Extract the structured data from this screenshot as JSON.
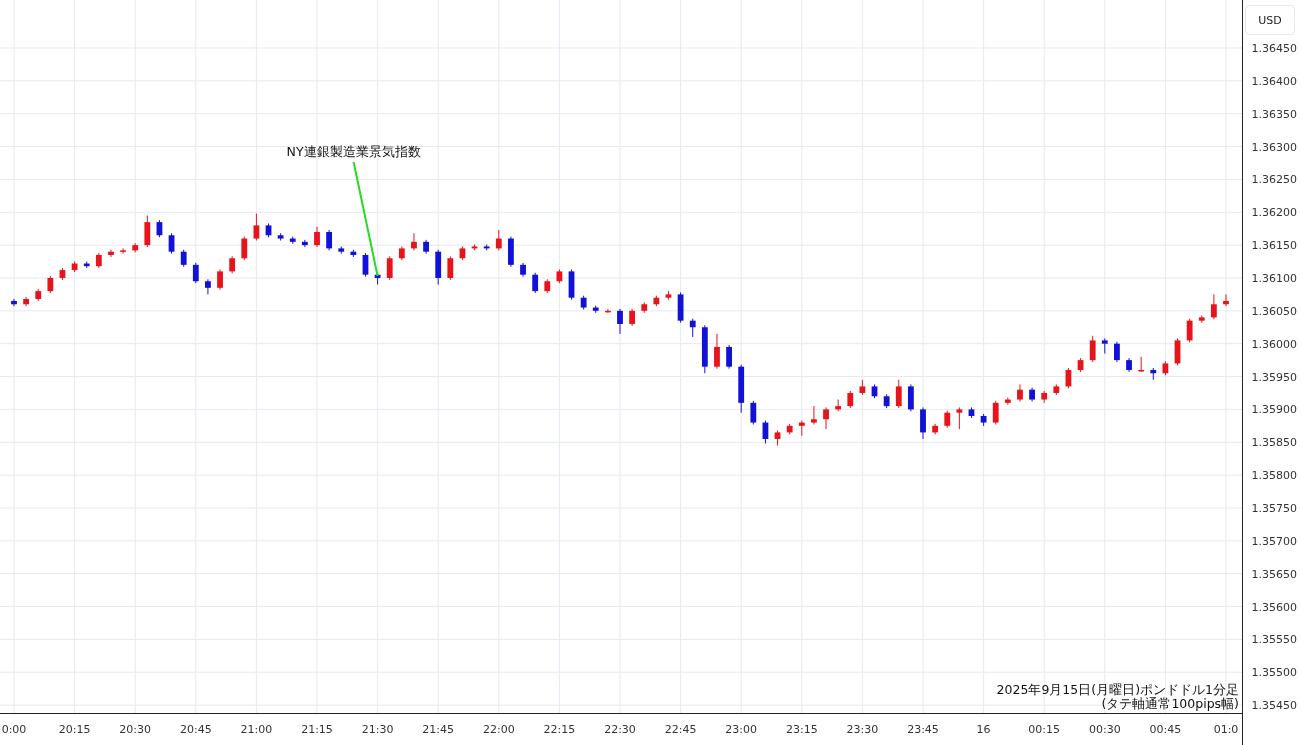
{
  "currency_button": {
    "label": "USD"
  },
  "chart": {
    "chart_data": {
      "type": "candlestick",
      "grid": true,
      "categories": [
        "0:00",
        null,
        null,
        null,
        null,
        "20:15",
        null,
        null,
        null,
        null,
        "20:30",
        null,
        null,
        null,
        null,
        "20:45",
        null,
        null,
        null,
        null,
        "21:00",
        null,
        null,
        null,
        null,
        "21:15",
        null,
        null,
        null,
        null,
        "21:30",
        null,
        null,
        null,
        null,
        "21:45",
        null,
        null,
        null,
        null,
        "22:00",
        null,
        null,
        null,
        null,
        "22:15",
        null,
        null,
        null,
        null,
        "22:30",
        null,
        null,
        null,
        null,
        "22:45",
        null,
        null,
        null,
        null,
        "23:00",
        null,
        null,
        null,
        null,
        "23:15",
        null,
        null,
        null,
        null,
        "23:30",
        null,
        null,
        null,
        null,
        "23:45",
        null,
        null,
        null,
        null,
        "16",
        null,
        null,
        null,
        null,
        "00:15",
        null,
        null,
        null,
        null,
        "00:30",
        null,
        null,
        null,
        null,
        "00:45",
        null,
        null,
        null,
        null,
        "01:0"
      ],
      "ohlc": [
        [
          1.36065,
          1.36068,
          1.36057,
          1.3606
        ],
        [
          1.3606,
          1.36071,
          1.36057,
          1.36068
        ],
        [
          1.36068,
          1.36083,
          1.36065,
          1.3608
        ],
        [
          1.3608,
          1.36103,
          1.36077,
          1.361
        ],
        [
          1.361,
          1.36115,
          1.36097,
          1.36112
        ],
        [
          1.36112,
          1.36125,
          1.36109,
          1.36122
        ],
        [
          1.36122,
          1.36125,
          1.36115,
          1.36118
        ],
        [
          1.36118,
          1.36138,
          1.36115,
          1.36135
        ],
        [
          1.36135,
          1.36143,
          1.36132,
          1.3614
        ],
        [
          1.3614,
          1.36145,
          1.36137,
          1.36142
        ],
        [
          1.36142,
          1.36153,
          1.36139,
          1.3615
        ],
        [
          1.3615,
          1.36195,
          1.36147,
          1.36185
        ],
        [
          1.36185,
          1.36188,
          1.36162,
          1.36165
        ],
        [
          1.36165,
          1.36168,
          1.36137,
          1.3614
        ],
        [
          1.3614,
          1.36143,
          1.36117,
          1.3612
        ],
        [
          1.3612,
          1.36123,
          1.36092,
          1.36095
        ],
        [
          1.36095,
          1.36098,
          1.36075,
          1.36085
        ],
        [
          1.36085,
          1.36113,
          1.36082,
          1.3611
        ],
        [
          1.3611,
          1.36133,
          1.36107,
          1.3613
        ],
        [
          1.3613,
          1.36163,
          1.36127,
          1.3616
        ],
        [
          1.3616,
          1.36198,
          1.36157,
          1.3618
        ],
        [
          1.3618,
          1.36183,
          1.36162,
          1.36165
        ],
        [
          1.36165,
          1.36168,
          1.36157,
          1.3616
        ],
        [
          1.3616,
          1.36163,
          1.36152,
          1.36155
        ],
        [
          1.36155,
          1.36158,
          1.36147,
          1.3615
        ],
        [
          1.3615,
          1.36178,
          1.36147,
          1.3617
        ],
        [
          1.3617,
          1.36173,
          1.36142,
          1.36145
        ],
        [
          1.36145,
          1.36148,
          1.36137,
          1.3614
        ],
        [
          1.3614,
          1.36143,
          1.36132,
          1.36135
        ],
        [
          1.36135,
          1.36138,
          1.36102,
          1.36105
        ],
        [
          1.36105,
          1.36108,
          1.3609,
          1.361
        ],
        [
          1.361,
          1.36133,
          1.36097,
          1.3613
        ],
        [
          1.3613,
          1.36148,
          1.36127,
          1.36145
        ],
        [
          1.36145,
          1.36168,
          1.36142,
          1.36155
        ],
        [
          1.36155,
          1.36158,
          1.36137,
          1.3614
        ],
        [
          1.3614,
          1.36143,
          1.3609,
          1.361
        ],
        [
          1.361,
          1.36133,
          1.36097,
          1.3613
        ],
        [
          1.3613,
          1.36148,
          1.36127,
          1.36145
        ],
        [
          1.36145,
          1.36151,
          1.36142,
          1.36148
        ],
        [
          1.36148,
          1.36151,
          1.36142,
          1.36145
        ],
        [
          1.36145,
          1.36173,
          1.36142,
          1.3616
        ],
        [
          1.3616,
          1.36163,
          1.36117,
          1.3612
        ],
        [
          1.3612,
          1.36123,
          1.36102,
          1.36105
        ],
        [
          1.36105,
          1.36108,
          1.36077,
          1.3608
        ],
        [
          1.3608,
          1.36098,
          1.36077,
          1.36095
        ],
        [
          1.36095,
          1.36113,
          1.36092,
          1.3611
        ],
        [
          1.3611,
          1.36113,
          1.36067,
          1.3607
        ],
        [
          1.3607,
          1.36073,
          1.36052,
          1.36055
        ],
        [
          1.36055,
          1.36058,
          1.36047,
          1.3605
        ],
        [
          1.3605,
          1.36053,
          1.36047,
          1.3605
        ],
        [
          1.3605,
          1.36053,
          1.36015,
          1.3603
        ],
        [
          1.3603,
          1.36053,
          1.36027,
          1.3605
        ],
        [
          1.3605,
          1.36063,
          1.36047,
          1.3606
        ],
        [
          1.3606,
          1.36073,
          1.36057,
          1.3607
        ],
        [
          1.3607,
          1.3608,
          1.36067,
          1.36075
        ],
        [
          1.36075,
          1.36078,
          1.36032,
          1.36035
        ],
        [
          1.36035,
          1.36038,
          1.3601,
          1.36025
        ],
        [
          1.36025,
          1.36028,
          1.35955,
          1.35965
        ],
        [
          1.35965,
          1.36015,
          1.35962,
          1.35995
        ],
        [
          1.35995,
          1.35998,
          1.35962,
          1.35965
        ],
        [
          1.35965,
          1.35968,
          1.35895,
          1.3591
        ],
        [
          1.3591,
          1.35913,
          1.35877,
          1.3588
        ],
        [
          1.3588,
          1.35883,
          1.35848,
          1.35855
        ],
        [
          1.35855,
          1.35868,
          1.35845,
          1.35865
        ],
        [
          1.35865,
          1.35878,
          1.35862,
          1.35875
        ],
        [
          1.35875,
          1.35883,
          1.3586,
          1.3588
        ],
        [
          1.3588,
          1.35905,
          1.35877,
          1.35885
        ],
        [
          1.35885,
          1.35903,
          1.3587,
          1.359
        ],
        [
          1.359,
          1.35915,
          1.35897,
          1.35905
        ],
        [
          1.35905,
          1.35928,
          1.35902,
          1.35925
        ],
        [
          1.35925,
          1.35945,
          1.35922,
          1.35935
        ],
        [
          1.35935,
          1.35938,
          1.35917,
          1.3592
        ],
        [
          1.3592,
          1.35923,
          1.35902,
          1.35905
        ],
        [
          1.35905,
          1.35945,
          1.35902,
          1.35935
        ],
        [
          1.35935,
          1.35938,
          1.35897,
          1.359
        ],
        [
          1.359,
          1.35903,
          1.35855,
          1.35865
        ],
        [
          1.35865,
          1.35878,
          1.35862,
          1.35875
        ],
        [
          1.35875,
          1.35898,
          1.35872,
          1.35895
        ],
        [
          1.35895,
          1.35903,
          1.3587,
          1.359
        ],
        [
          1.359,
          1.35903,
          1.35887,
          1.3589
        ],
        [
          1.3589,
          1.35893,
          1.35875,
          1.3588
        ],
        [
          1.3588,
          1.35913,
          1.35877,
          1.3591
        ],
        [
          1.3591,
          1.35918,
          1.35907,
          1.35915
        ],
        [
          1.35915,
          1.35938,
          1.35912,
          1.3593
        ],
        [
          1.3593,
          1.35933,
          1.35912,
          1.35915
        ],
        [
          1.35915,
          1.35928,
          1.3591,
          1.35925
        ],
        [
          1.35925,
          1.35938,
          1.35922,
          1.35935
        ],
        [
          1.35935,
          1.35963,
          1.35932,
          1.3596
        ],
        [
          1.3596,
          1.35978,
          1.35957,
          1.35975
        ],
        [
          1.35975,
          1.36012,
          1.35972,
          1.36005
        ],
        [
          1.36005,
          1.36008,
          1.35985,
          1.36
        ],
        [
          1.36,
          1.36003,
          1.35972,
          1.35975
        ],
        [
          1.35975,
          1.35978,
          1.35957,
          1.3596
        ],
        [
          1.3596,
          1.3598,
          1.35957,
          1.3596
        ],
        [
          1.3596,
          1.35963,
          1.35945,
          1.35955
        ],
        [
          1.35955,
          1.35973,
          1.35952,
          1.3597
        ],
        [
          1.3597,
          1.36008,
          1.35967,
          1.36005
        ],
        [
          1.36005,
          1.36038,
          1.36002,
          1.36035
        ],
        [
          1.36035,
          1.36043,
          1.36032,
          1.3604
        ],
        [
          1.3604,
          1.36075,
          1.36037,
          1.3606
        ],
        [
          1.3606,
          1.36075,
          1.36057,
          1.36065
        ]
      ],
      "ylim": [
        1.35438,
        1.36523
      ],
      "yticks": [
        {
          "value": 1.3645,
          "label": "1.36450"
        },
        {
          "value": 1.364,
          "label": "1.36400"
        },
        {
          "value": 1.3635,
          "label": "1.36350"
        },
        {
          "value": 1.363,
          "label": "1.36300"
        },
        {
          "value": 1.3625,
          "label": "1.36250"
        },
        {
          "value": 1.362,
          "label": "1.36200"
        },
        {
          "value": 1.3615,
          "label": "1.36150"
        },
        {
          "value": 1.361,
          "label": "1.36100"
        },
        {
          "value": 1.3605,
          "label": "1.36050"
        },
        {
          "value": 1.36,
          "label": "1.36000"
        },
        {
          "value": 1.3595,
          "label": "1.35950"
        },
        {
          "value": 1.359,
          "label": "1.35900"
        },
        {
          "value": 1.3585,
          "label": "1.35850"
        },
        {
          "value": 1.358,
          "label": "1.35800"
        },
        {
          "value": 1.3575,
          "label": "1.35750"
        },
        {
          "value": 1.357,
          "label": "1.35700"
        },
        {
          "value": 1.3565,
          "label": "1.35650"
        },
        {
          "value": 1.356,
          "label": "1.35600"
        },
        {
          "value": 1.3555,
          "label": "1.35550"
        },
        {
          "value": 1.355,
          "label": "1.35500"
        },
        {
          "value": 1.3545,
          "label": "1.35450"
        }
      ],
      "annotations": [
        {
          "text": "NY連銀製造業景気指数",
          "x": "21:30",
          "y": 1.361
        }
      ]
    },
    "caption_lines": [
      "2025年9月15日(月曜日)ポンドドル1分足",
      "(タテ軸通常100pips幅)"
    ]
  }
}
